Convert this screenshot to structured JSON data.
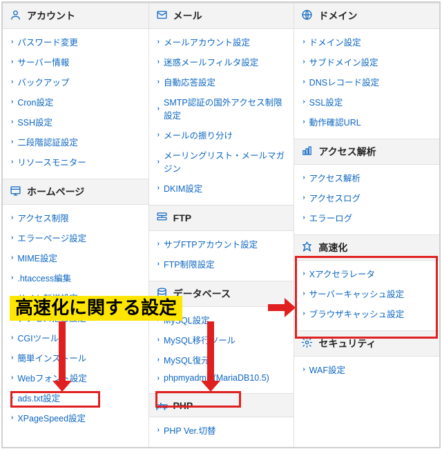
{
  "annotation": {
    "banner_text": "高速化に関する設定"
  },
  "columns": [
    {
      "sections": [
        {
          "icon": "user",
          "title": "アカウント",
          "items": [
            "パスワード変更",
            "サーバー情報",
            "バックアップ",
            "Cron設定",
            "SSH設定",
            "二段階認証設定",
            "リソースモニター"
          ]
        },
        {
          "icon": "homepage",
          "title": "ホームページ",
          "items": [
            "アクセス制限",
            "エラーページ設定",
            "MIME設定",
            ".htaccess編集",
            "サイト転送設定",
            "アクセス拒否設定",
            "CGIツール",
            "簡単インストール",
            "Webフォント設定",
            "ads.txt設定",
            "XPageSpeed設定"
          ]
        }
      ]
    },
    {
      "sections": [
        {
          "icon": "mail",
          "title": "メール",
          "items": [
            "メールアカウント設定",
            "迷惑メールフィルタ設定",
            "自動応答設定",
            "SMTP認証の国外アクセス制限設定",
            "メールの振り分け",
            "メーリングリスト・メールマガジン",
            "DKIM設定"
          ]
        },
        {
          "icon": "ftp",
          "title": "FTP",
          "items": [
            "サブFTPアカウント設定",
            "FTP制限設定"
          ]
        },
        {
          "icon": "database",
          "title": "データベース",
          "items": [
            "MySQL設定",
            "MySQL移行ツール",
            "MySQL復元",
            "phpmyadmin(MariaDB10.5)"
          ]
        },
        {
          "icon": "php",
          "title": "PHP",
          "items": [
            "PHP Ver.切替"
          ]
        }
      ]
    },
    {
      "sections": [
        {
          "icon": "globe",
          "title": "ドメイン",
          "items": [
            "ドメイン設定",
            "サブドメイン設定",
            "DNSレコード設定",
            "SSL設定",
            "動作確認URL"
          ]
        },
        {
          "icon": "analytics",
          "title": "アクセス解析",
          "items": [
            "アクセス解析",
            "アクセスログ",
            "エラーログ"
          ]
        },
        {
          "icon": "speed",
          "title": "高速化",
          "items": [
            "Xアクセラレータ",
            "サーバーキャッシュ設定",
            "ブラウザキャッシュ設定"
          ]
        },
        {
          "icon": "security",
          "title": "セキュリティ",
          "items": [
            "WAF設定"
          ]
        }
      ]
    }
  ]
}
